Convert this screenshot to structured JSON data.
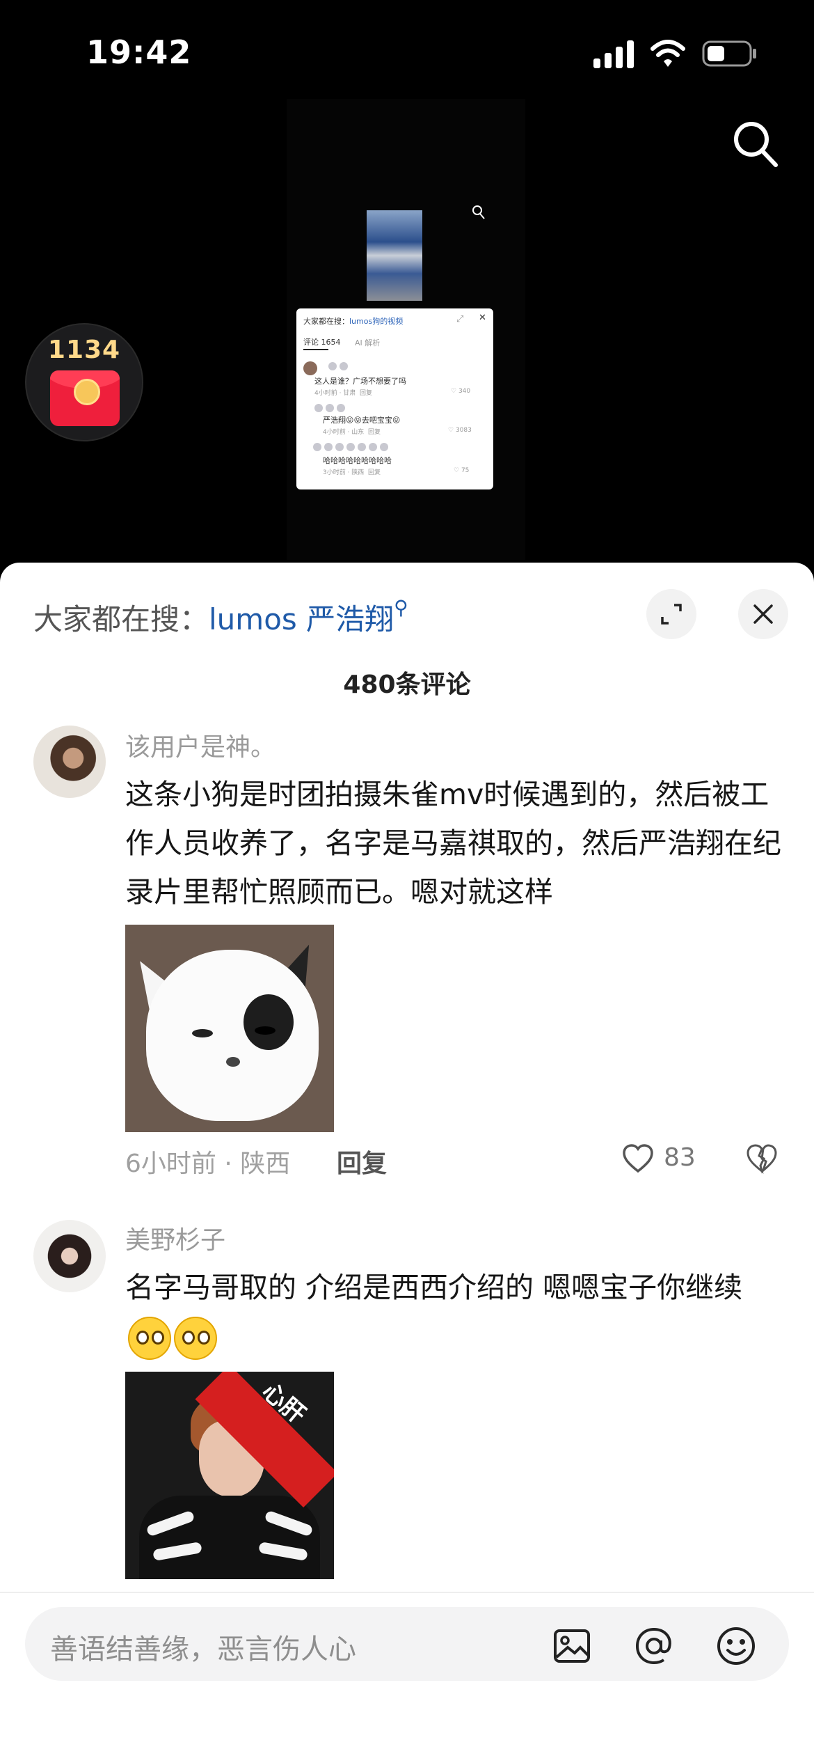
{
  "status_bar": {
    "time": "19:42"
  },
  "video": {
    "red_packet_count": "1134",
    "preview": {
      "hot_search_prefix": "大家都在搜：",
      "hot_search_keyword": "lumos狗的视频",
      "tab_comments": "评论 1654",
      "tab_ai": "AI 解析",
      "comments": [
        {
          "text": "这人是谁？广场不想要了吗",
          "meta": "4小时前 · 甘肃",
          "reply": "回复",
          "likes": "340"
        },
        {
          "text": "严浩翔😝😝去吧宝宝😝",
          "meta": "4小时前 · 山东",
          "reply": "回复",
          "likes": "3083"
        },
        {
          "text": "哈哈哈哈哈哈哈哈哈",
          "meta": "3小时前 · 陕西",
          "reply": "回复",
          "likes": "75"
        }
      ]
    }
  },
  "sheet": {
    "hot_search_prefix": "大家都在搜：",
    "hot_search_keyword": "lumos 严浩翔",
    "comment_count_title": "480条评论",
    "comments": [
      {
        "username": "该用户是神。",
        "text": "这条小狗是时团拍摄朱雀mv时候遇到的，然后被工作人员收养了，名字是马嘉祺取的，然后严浩翔在纪录片里帮忙照顾而已。嗯对就这样",
        "meta": "6小时前 · 陕西",
        "reply": "回复",
        "likes": "83"
      },
      {
        "username": "美野杉子",
        "text": "名字马哥取的 介绍是西西介绍的 嗯嗯宝子你继续",
        "sticker_text": "心肝"
      }
    ],
    "input_placeholder": "善语结善缘，恶言伤人心"
  },
  "colors": {
    "link_blue": "#1f5aa8",
    "red_packet": "#ef1f3c"
  }
}
